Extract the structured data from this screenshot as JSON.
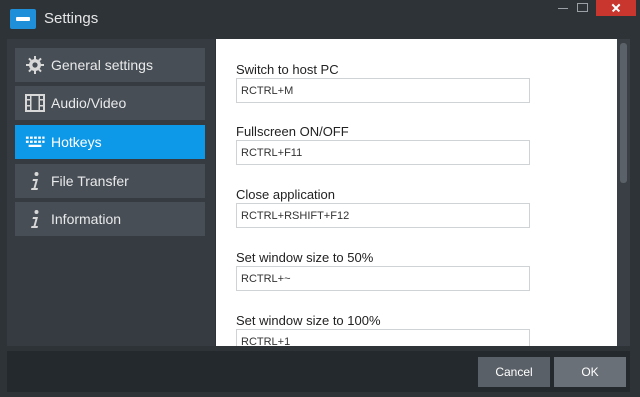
{
  "window": {
    "title": "Settings"
  },
  "sidebar": {
    "items": [
      {
        "label": "General settings",
        "icon": "gear-icon",
        "active": false
      },
      {
        "label": "Audio/Video",
        "icon": "film-icon",
        "active": false
      },
      {
        "label": "Hotkeys",
        "icon": "keyboard-icon",
        "active": true
      },
      {
        "label": "File Transfer",
        "icon": "info-icon",
        "active": false
      },
      {
        "label": "Information",
        "icon": "info-icon",
        "active": false
      }
    ]
  },
  "hotkeys": [
    {
      "label": "Switch to host PC",
      "value": "RCTRL+M"
    },
    {
      "label": "Fullscreen ON/OFF",
      "value": "RCTRL+F11"
    },
    {
      "label": "Close application",
      "value": "RCTRL+RSHIFT+F12"
    },
    {
      "label": "Set window size to 50%",
      "value": "RCTRL+~"
    },
    {
      "label": "Set window size to 100%",
      "value": "RCTRL+1"
    }
  ],
  "footer": {
    "cancel_label": "Cancel",
    "ok_label": "OK"
  },
  "colors": {
    "accent": "#0e98e8",
    "close": "#c8362e"
  }
}
